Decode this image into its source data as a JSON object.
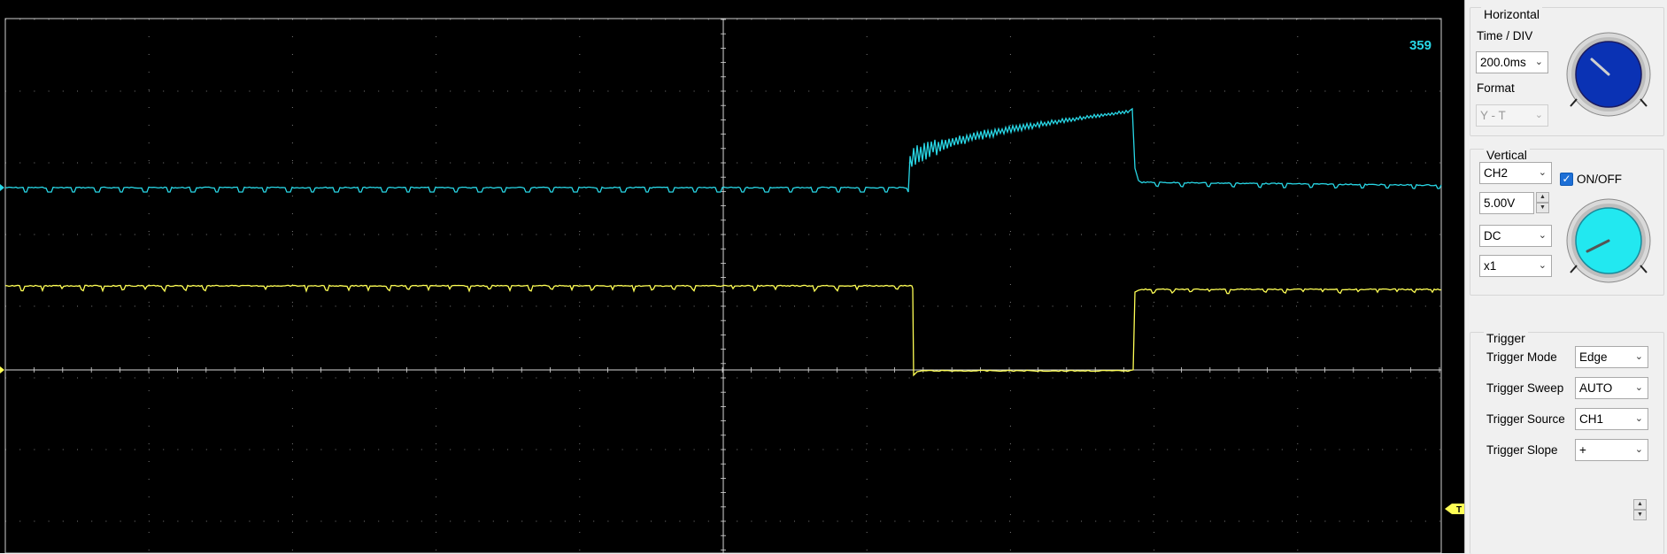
{
  "scope": {
    "counter": "359",
    "trigger_marker": "T",
    "colors": {
      "ch1": "#ffff55",
      "ch2": "#28d7e6",
      "grid": "#7a7a7a",
      "axis": "#d8d8d8",
      "counter": "#28d7e6",
      "background": "#000000"
    }
  },
  "horizontal": {
    "title": "Horizontal",
    "time_div_label": "Time / DIV",
    "time_div_value": "200.0ms",
    "format_label": "Format",
    "format_value": "Y - T",
    "knob_color": "#0a32b4"
  },
  "vertical": {
    "title": "Vertical",
    "channel_value": "CH2",
    "onoff_label": "ON/OFF",
    "onoff_checked": true,
    "volts_value": "5.00V",
    "coupling_value": "DC",
    "probe_value": "x1",
    "knob_color": "#22e8f0"
  },
  "trigger": {
    "title": "Trigger",
    "mode_label": "Trigger Mode",
    "mode_value": "Edge",
    "sweep_label": "Trigger Sweep",
    "sweep_value": "AUTO",
    "source_label": "Trigger Source",
    "source_value": "CH1",
    "slope_label": "Trigger Slope",
    "slope_value": "+"
  }
}
